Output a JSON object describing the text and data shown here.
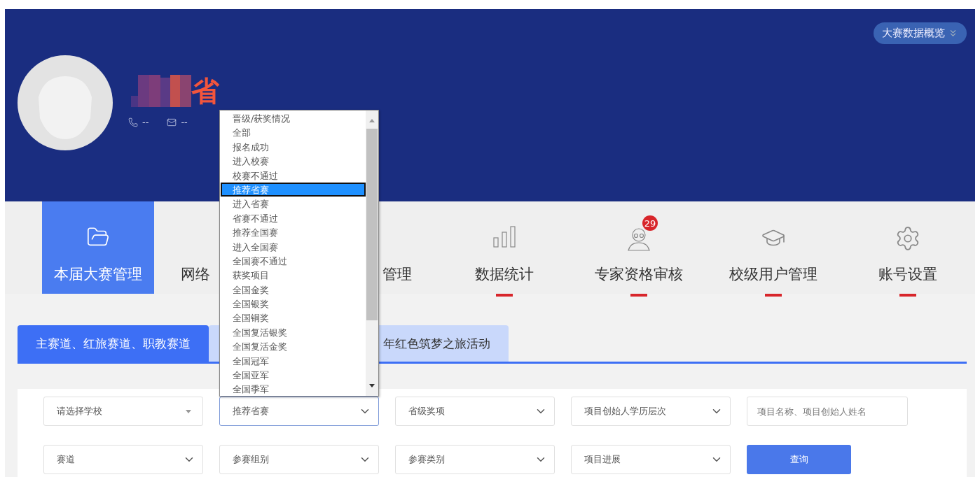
{
  "header": {
    "name": "省",
    "phone": "--",
    "email": "--",
    "overview_button": "大赛数据概览"
  },
  "nav": [
    {
      "label": "本届大赛管理",
      "selected": true,
      "marked": false
    },
    {
      "label": "网络",
      "selected": false,
      "marked": false
    },
    {
      "label": "管理",
      "selected": false,
      "marked": false
    },
    {
      "label": "数据统计",
      "selected": false,
      "marked": true
    },
    {
      "label": "专家资格审核",
      "selected": false,
      "marked": true,
      "badge": "29"
    },
    {
      "label": "校级用户管理",
      "selected": false,
      "marked": true
    },
    {
      "label": "账号设置",
      "selected": false,
      "marked": true
    }
  ],
  "tabs": [
    {
      "label": "主赛道、红旅赛道、职教赛道",
      "selected": true
    },
    {
      "label": "年红色筑梦之旅活动",
      "selected": false
    }
  ],
  "filters": [
    [
      {
        "kind": "select",
        "value": "请选择学校",
        "open": false
      },
      {
        "kind": "select",
        "value": "推荐省赛",
        "open": true
      },
      {
        "kind": "select",
        "value": "省级奖项",
        "open": false
      },
      {
        "kind": "select",
        "value": "项目创始人学历层次",
        "open": false
      },
      {
        "kind": "input",
        "placeholder": "项目名称、项目创始人姓名"
      }
    ],
    [
      {
        "kind": "select",
        "value": "赛道",
        "open": false
      },
      {
        "kind": "select",
        "value": "参赛组别",
        "open": false
      },
      {
        "kind": "select",
        "value": "参赛类别",
        "open": false
      },
      {
        "kind": "select",
        "value": "项目进展",
        "open": false
      },
      {
        "kind": "button",
        "label": "查询"
      }
    ]
  ],
  "dropdown_options": [
    {
      "label": "晋级/获奖情况",
      "selected": false
    },
    {
      "label": "全部",
      "selected": false
    },
    {
      "label": "报名成功",
      "selected": false
    },
    {
      "label": "进入校赛",
      "selected": false
    },
    {
      "label": "校赛不通过",
      "selected": false
    },
    {
      "label": "推荐省赛",
      "selected": true
    },
    {
      "label": "进入省赛",
      "selected": false
    },
    {
      "label": "省赛不通过",
      "selected": false
    },
    {
      "label": "推荐全国赛",
      "selected": false
    },
    {
      "label": "进入全国赛",
      "selected": false
    },
    {
      "label": "全国赛不通过",
      "selected": false
    },
    {
      "label": "获奖项目",
      "selected": false
    },
    {
      "label": "全国金奖",
      "selected": false
    },
    {
      "label": "全国银奖",
      "selected": false
    },
    {
      "label": "全国铜奖",
      "selected": false
    },
    {
      "label": "全国复活银奖",
      "selected": false
    },
    {
      "label": "全国复活金奖",
      "selected": false
    },
    {
      "label": "全国冠军",
      "selected": false
    },
    {
      "label": "全国亚军",
      "selected": false
    },
    {
      "label": "全国季军",
      "selected": false
    }
  ]
}
